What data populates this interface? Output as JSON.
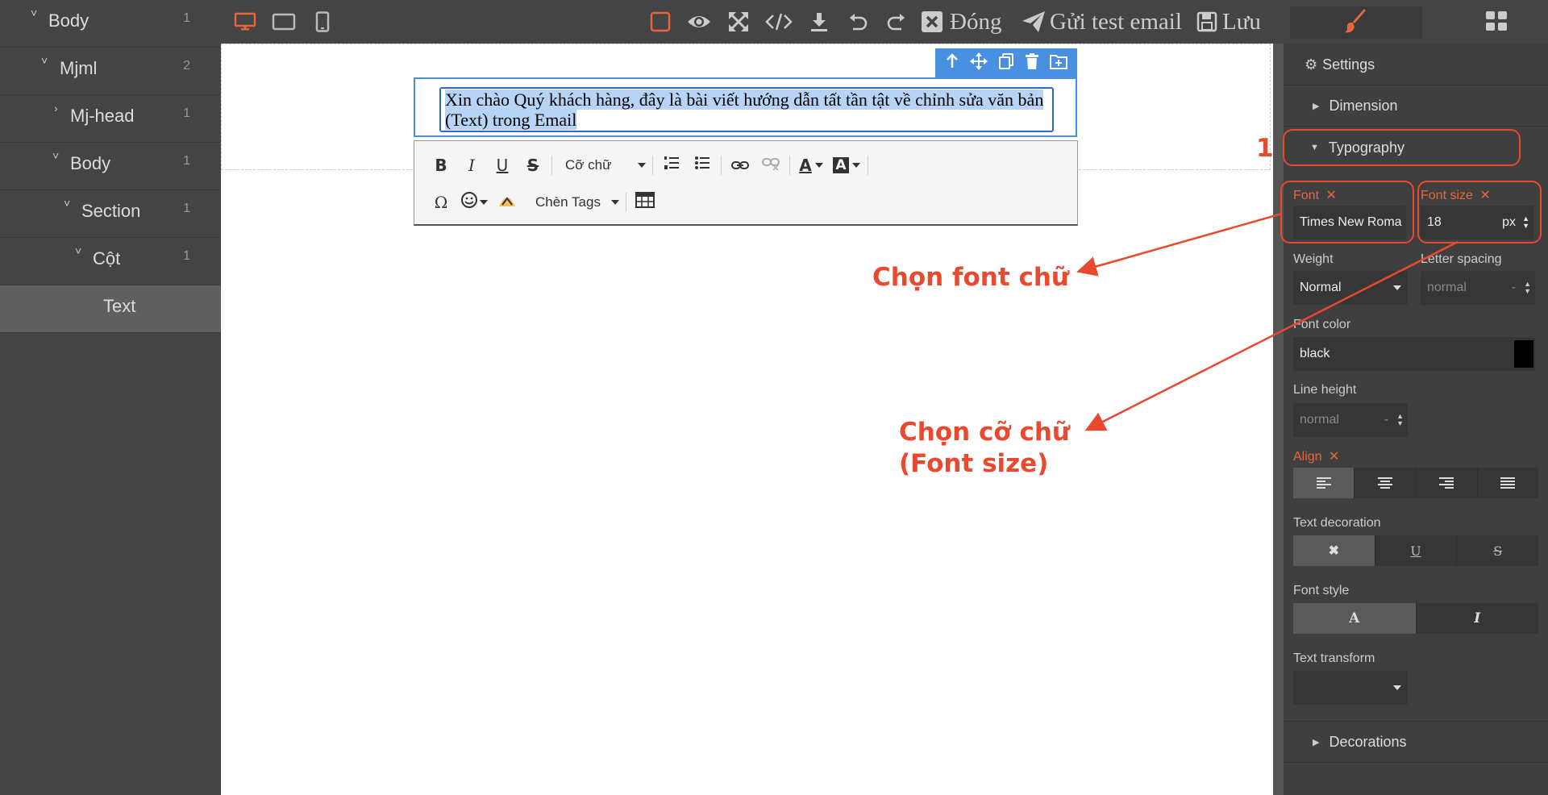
{
  "layers": [
    {
      "name": "Body",
      "count": "1"
    },
    {
      "name": "Mjml",
      "count": "2"
    },
    {
      "name": "Mj-head",
      "count": "1"
    },
    {
      "name": "Body",
      "count": "1"
    },
    {
      "name": "Section",
      "count": "1"
    },
    {
      "name": "Cột",
      "count": "1"
    },
    {
      "name": "Text",
      "count": ""
    }
  ],
  "topbar": {
    "close_label": "Đóng",
    "send_test_label": "Gửi test email",
    "save_label": "Lưu"
  },
  "canvas": {
    "selected_text": "Xin chào Quý khách hàng, đây là bài viết hướng dẫn tất tần tật về chỉnh sửa văn bản (Text) trong Email"
  },
  "rte": {
    "font_size_select": "Cỡ chữ",
    "tags_select": "Chèn Tags"
  },
  "annotations": {
    "font_callout": "Chọn font chữ",
    "size_callout_line1": "Chọn cỡ chữ",
    "size_callout_line2": "(Font size)",
    "partial_number": "1"
  },
  "panel": {
    "settings": "Settings",
    "dimension": "Dimension",
    "typography": "Typography",
    "font_label": "Font",
    "font_value": "Times New Roma",
    "font_size_label": "Font size",
    "font_size_value": "18",
    "font_size_unit": "px",
    "weight_label": "Weight",
    "weight_value": "Normal",
    "letter_spacing_label": "Letter spacing",
    "letter_spacing_value": "normal",
    "letter_spacing_unit": "-",
    "font_color_label": "Font color",
    "font_color_value": "black",
    "line_height_label": "Line height",
    "line_height_value": "normal",
    "line_height_unit": "-",
    "align_label": "Align",
    "text_decoration_label": "Text decoration",
    "font_style_label": "Font style",
    "text_transform_label": "Text transform",
    "decorations": "Decorations"
  },
  "colors": {
    "accent": "#e8492f",
    "selection": "#4a90e2",
    "active_device": "#e8663e"
  }
}
